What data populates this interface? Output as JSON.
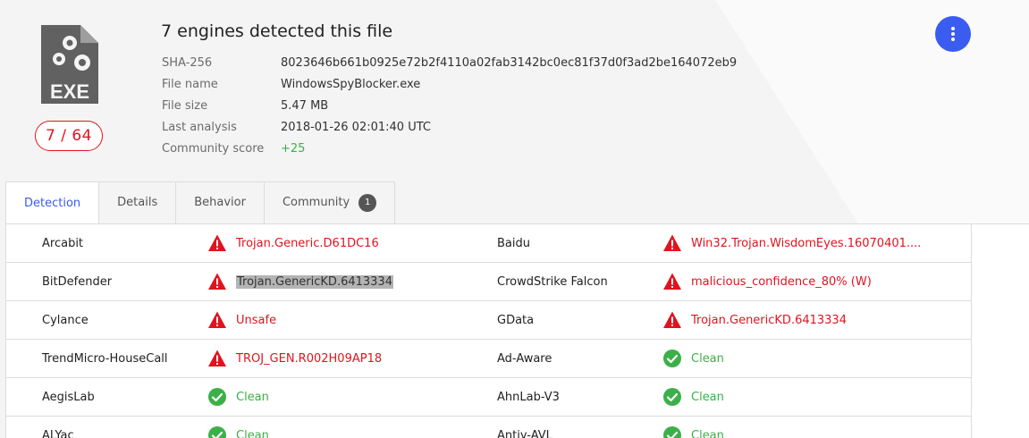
{
  "file": {
    "icon_name": "exe-file-icon",
    "icon_text": "EXE",
    "score": "7 / 64",
    "title": "7 engines detected this file",
    "details": [
      {
        "key": "SHA-256",
        "value": "8023646b661b0925e72b2f4110a02fab3142bc0ec81f37d0f3ad2be164072eb9"
      },
      {
        "key": "File name",
        "value": "WindowsSpyBlocker.exe"
      },
      {
        "key": "File size",
        "value": "5.47 MB"
      },
      {
        "key": "Last analysis",
        "value": "2018-01-26 02:01:40 UTC"
      },
      {
        "key": "Community score",
        "value": "+25"
      }
    ]
  },
  "menu_button": {
    "icon": "more-vertical-icon"
  },
  "tabs": [
    {
      "label": "Detection",
      "active": true
    },
    {
      "label": "Details"
    },
    {
      "label": "Behavior"
    },
    {
      "label": "Community",
      "count": "1"
    }
  ],
  "detections": [
    {
      "left": {
        "engine": "Arcabit",
        "result": "Trojan.Generic.D61DC16",
        "status": "malicious"
      },
      "right": {
        "engine": "Baidu",
        "result": "Win32.Trojan.WisdomEyes.16070401....",
        "status": "malicious"
      }
    },
    {
      "left": {
        "engine": "BitDefender",
        "result": "Trojan.GenericKD.6413334",
        "status": "malicious",
        "highlighted": true
      },
      "right": {
        "engine": "CrowdStrike Falcon",
        "result": "malicious_confidence_80% (W)",
        "status": "malicious"
      }
    },
    {
      "left": {
        "engine": "Cylance",
        "result": "Unsafe",
        "status": "malicious"
      },
      "right": {
        "engine": "GData",
        "result": "Trojan.GenericKD.6413334",
        "status": "malicious"
      }
    },
    {
      "left": {
        "engine": "TrendMicro-HouseCall",
        "result": "TROJ_GEN.R002H09AP18",
        "status": "malicious"
      },
      "right": {
        "engine": "Ad-Aware",
        "result": "Clean",
        "status": "clean"
      }
    },
    {
      "left": {
        "engine": "AegisLab",
        "result": "Clean",
        "status": "clean"
      },
      "right": {
        "engine": "AhnLab-V3",
        "result": "Clean",
        "status": "clean"
      }
    },
    {
      "left": {
        "engine": "ALYac",
        "result": "Clean",
        "status": "clean"
      },
      "right": {
        "engine": "Antiy-AVL",
        "result": "Clean",
        "status": "clean"
      }
    }
  ],
  "colors": {
    "accent": "#3b5cf0",
    "malicious": "#e0141e",
    "clean": "#3cb048"
  }
}
